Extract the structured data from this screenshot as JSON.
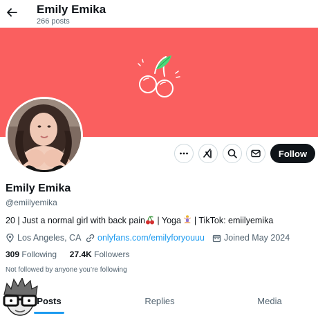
{
  "header": {
    "title": "Emily Emika",
    "post_count": "266 posts"
  },
  "actions": {
    "follow_label": "Follow"
  },
  "profile": {
    "name": "Emily Emika",
    "handle": "@emiilyemika",
    "bio_part1": "20 | Just a normal girl with back pain",
    "bio_part2": " | Yoga ",
    "bio_part3": " | TikTok: emiilyemika",
    "location": "Los Angeles, CA",
    "website": "onlyfans.com/emilyforyouuu",
    "joined": "Joined May 2024",
    "following_count": "309",
    "following_label": "Following",
    "followers_count": "27.4K",
    "followers_label": "Followers",
    "followed_note": "Not followed by anyone you’re following"
  },
  "tabs": [
    {
      "label": "Posts"
    },
    {
      "label": "Replies"
    },
    {
      "label": "Media"
    }
  ],
  "colors": {
    "banner": "#fa5f5f",
    "accent": "#1d9bf0",
    "text": "#0f1419",
    "muted": "#536471"
  },
  "icons": [
    "back-arrow-icon",
    "cherry-icon",
    "more-icon",
    "grok-icon",
    "search-icon",
    "message-icon",
    "location-icon",
    "link-icon",
    "calendar-icon",
    "yoga-emoji",
    "cherries-emoji"
  ]
}
